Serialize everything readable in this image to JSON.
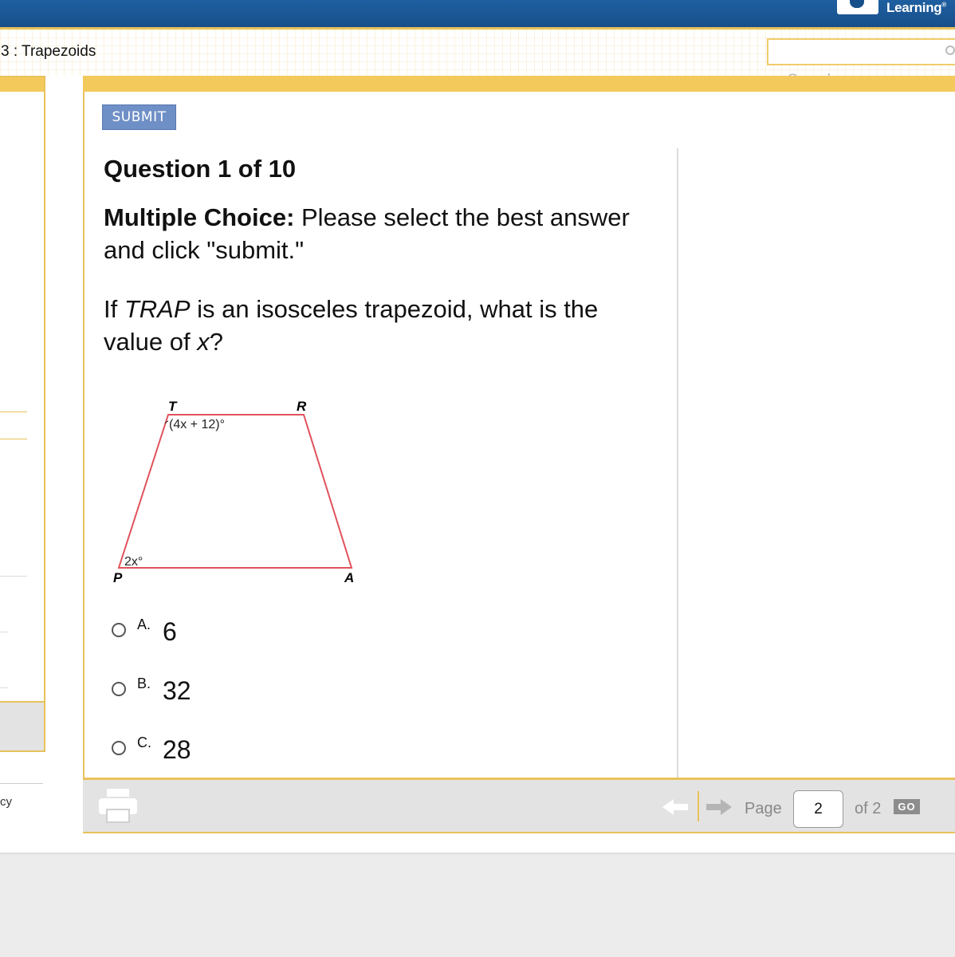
{
  "header": {
    "logo_text": "Learning",
    "breadcrumb": "3 : Trapezoids",
    "search_value": "",
    "search_label": "Search"
  },
  "sidebar": {
    "footer_link": "cy"
  },
  "quiz": {
    "submit_label": "SUBMIT",
    "question_number": "Question 1 of 10",
    "instruction_bold": "Multiple Choice:",
    "instruction_rest": " Please select the best answer and click \"submit.\"",
    "question": {
      "part1": "If ",
      "italic1": "TRAP",
      "part2": " is an isosceles trapezoid, what is the value of ",
      "italic2": "x",
      "part3": "?"
    },
    "diagram": {
      "vertex_T": "T",
      "vertex_R": "R",
      "vertex_P": "P",
      "vertex_A": "A",
      "angle_T": "(4x + 12)°",
      "angle_P": "2x°",
      "edge_color": "#e0525b"
    },
    "choices": [
      {
        "letter": "A.",
        "value": "6"
      },
      {
        "letter": "B.",
        "value": "32"
      },
      {
        "letter": "C.",
        "value": "28"
      }
    ]
  },
  "pager": {
    "page_label": "Page",
    "page_value": "2",
    "total_label": "of 2",
    "go_label": "GO"
  }
}
